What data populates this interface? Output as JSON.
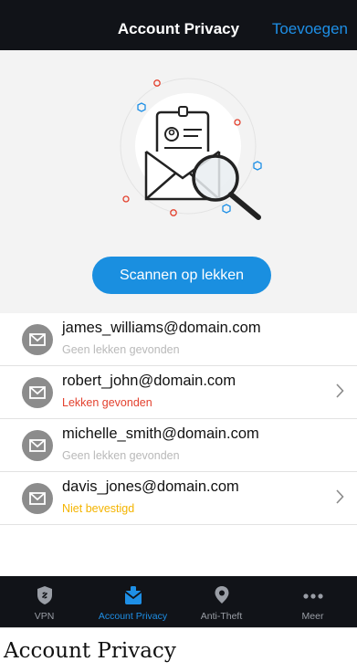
{
  "header": {
    "title": "Account Privacy",
    "action": "Toevoegen"
  },
  "hero": {
    "scan_button": "Scannen op lekken"
  },
  "accounts": [
    {
      "email": "james_williams@domain.com",
      "status": "Geen lekken gevonden",
      "status_type": "ok",
      "has_chevron": false
    },
    {
      "email": "robert_john@domain.com",
      "status": "Lekken gevonden",
      "status_type": "leak",
      "has_chevron": true
    },
    {
      "email": "michelle_smith@domain.com",
      "status": "Geen lekken gevonden",
      "status_type": "ok",
      "has_chevron": false
    },
    {
      "email": "davis_jones@domain.com",
      "status": "Niet bevestigd",
      "status_type": "pending",
      "has_chevron": true
    }
  ],
  "tabs": [
    {
      "label": "VPN",
      "icon": "vpn-shield-icon",
      "active": false
    },
    {
      "label": "Account Privacy",
      "icon": "account-privacy-icon",
      "active": true
    },
    {
      "label": "Anti-Theft",
      "icon": "location-pin-icon",
      "active": false
    },
    {
      "label": "Meer",
      "icon": "more-dots-icon",
      "active": false
    }
  ],
  "caption": "Account Privacy",
  "colors": {
    "accent": "#1e8fe6",
    "leak": "#e3412e",
    "pending": "#f4b400",
    "header_bg": "#111318"
  }
}
